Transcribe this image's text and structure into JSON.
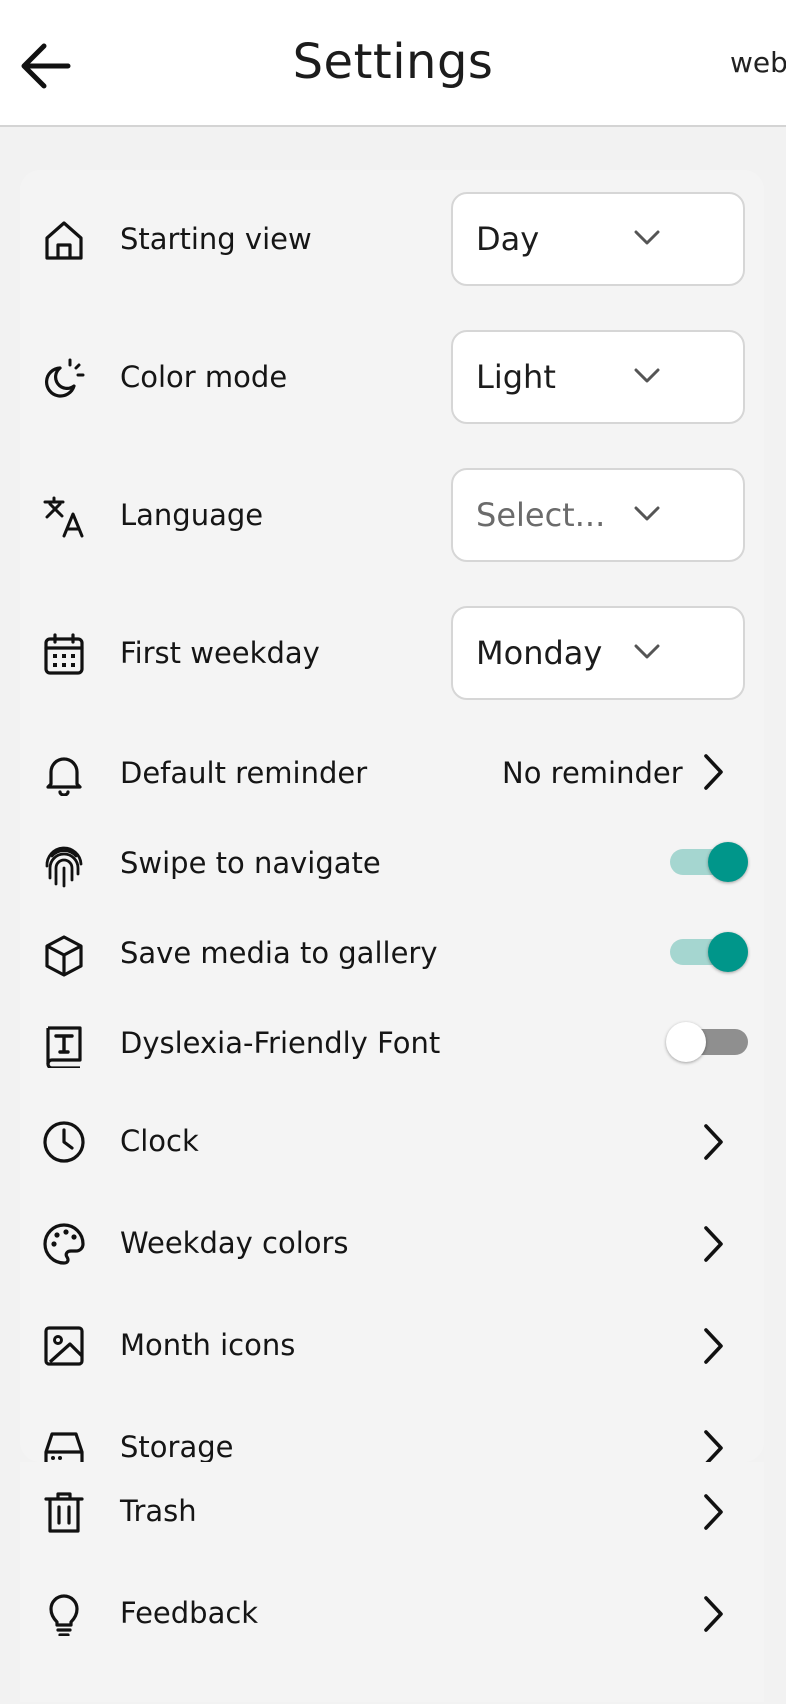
{
  "header": {
    "title": "Settings",
    "right_link": "web",
    "back_icon": "arrow-left-icon"
  },
  "settings": {
    "starting_view": {
      "label": "Starting view",
      "value": "Day",
      "icon": "home-icon"
    },
    "color_mode": {
      "label": "Color mode",
      "value": "Light",
      "icon": "moon-sun-icon"
    },
    "language": {
      "label": "Language",
      "placeholder": "Select...",
      "icon": "translate-icon"
    },
    "first_weekday": {
      "label": "First weekday",
      "value": "Monday",
      "icon": "calendar-icon"
    },
    "default_reminder": {
      "label": "Default reminder",
      "value": "No reminder",
      "icon": "bell-icon"
    },
    "swipe_to_navigate": {
      "label": "Swipe to navigate",
      "enabled": true,
      "icon": "fingerprint-icon"
    },
    "save_media": {
      "label": "Save media to gallery",
      "enabled": true,
      "icon": "cube-icon"
    },
    "dyslexia_font": {
      "label": "Dyslexia-Friendly Font",
      "enabled": false,
      "icon": "font-book-icon"
    },
    "clock": {
      "label": "Clock",
      "icon": "clock-icon"
    },
    "weekday_colors": {
      "label": "Weekday colors",
      "icon": "palette-icon"
    },
    "month_icons": {
      "label": "Month icons",
      "icon": "image-icon"
    },
    "storage": {
      "label": "Storage",
      "icon": "storage-icon"
    },
    "trash": {
      "label": "Trash",
      "icon": "trash-icon"
    },
    "feedback": {
      "label": "Feedback",
      "icon": "lightbulb-icon"
    }
  },
  "colors": {
    "accent": "#00968a",
    "accent_track": "#a5d6d0",
    "off_track": "#8f8f8f",
    "background": "#f2f2f2"
  }
}
